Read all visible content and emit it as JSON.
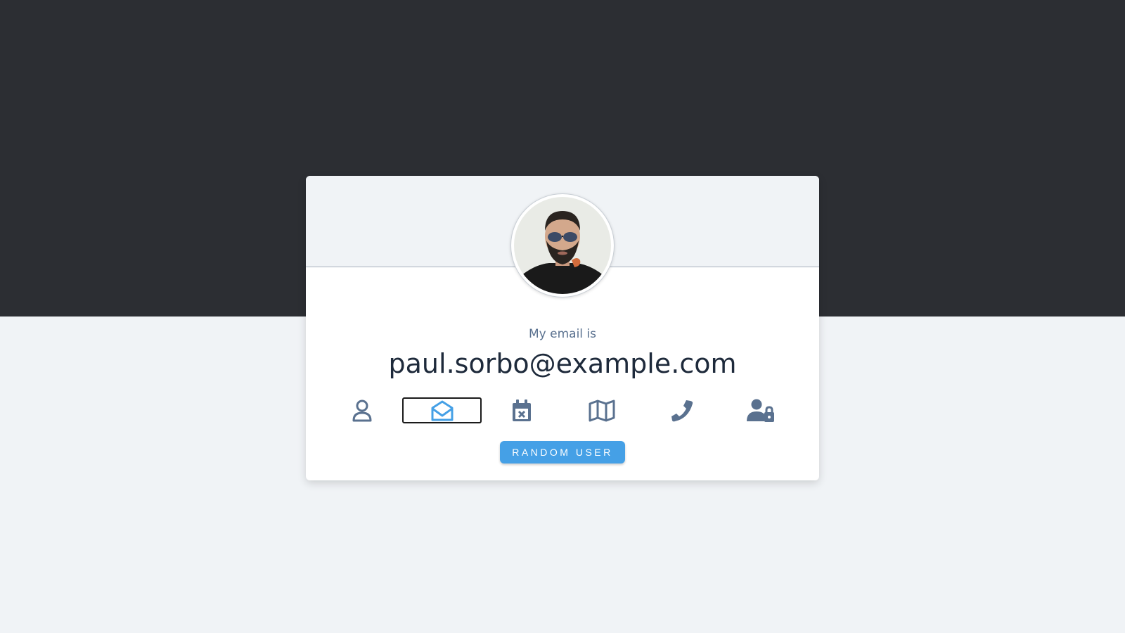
{
  "profile": {
    "label": "My email is",
    "value": "paul.sorbo@example.com"
  },
  "icons": [
    {
      "name": "user-icon",
      "active": false
    },
    {
      "name": "email-icon",
      "active": true
    },
    {
      "name": "calendar-icon",
      "active": false
    },
    {
      "name": "map-icon",
      "active": false
    },
    {
      "name": "phone-icon",
      "active": false
    },
    {
      "name": "user-lock-icon",
      "active": false
    }
  ],
  "button": {
    "label": "Random User"
  },
  "colors": {
    "dark_band": "#2c2e33",
    "background": "#f0f3f6",
    "icon": "#5a718f",
    "icon_active": "#45a0e6",
    "button": "#45a0e6",
    "text_primary": "#1e2a3b"
  }
}
